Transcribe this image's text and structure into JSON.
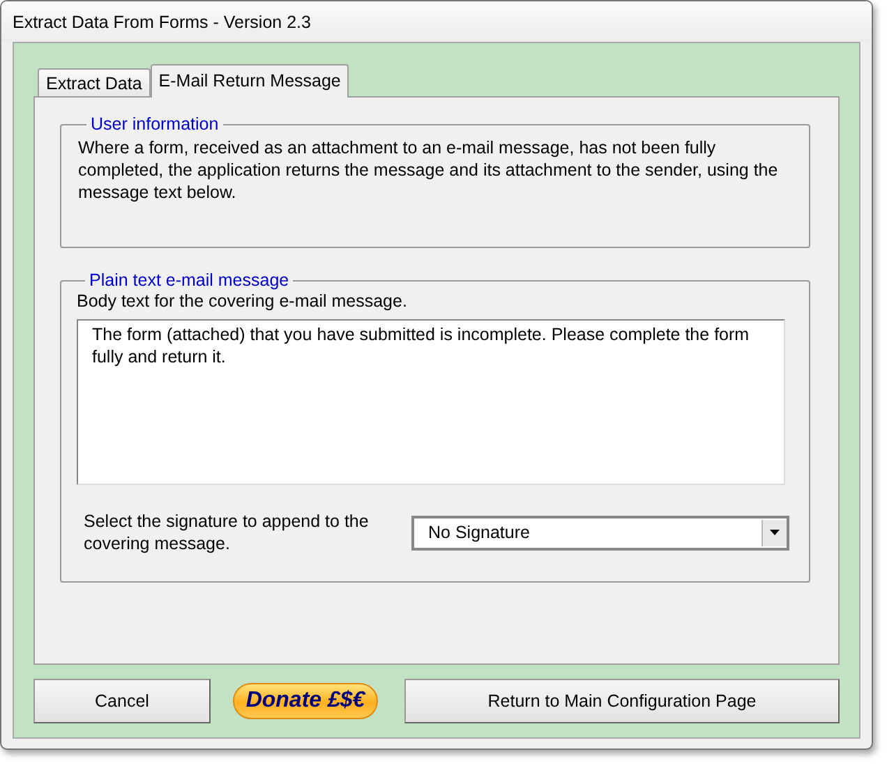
{
  "window": {
    "title": "Extract Data From Forms - Version 2.3"
  },
  "tabs": [
    {
      "label": "Extract Data",
      "selected": false
    },
    {
      "label": "E-Mail Return Message",
      "selected": true
    }
  ],
  "user_information": {
    "legend": "User information",
    "text": "Where a form, received as an attachment to an e-mail message, has not been fully completed, the application returns the message and its attachment to the sender, using the message text below."
  },
  "plain_text_message": {
    "legend": "Plain text e-mail message",
    "label": "Body text for the covering e-mail message.",
    "value": "The form (attached) that you have submitted is incomplete. Please complete the form fully and return it.",
    "signature_label": "Select the signature to append to the covering message.",
    "signature_value": "No Signature"
  },
  "buttons": {
    "cancel": "Cancel",
    "donate": "Donate £$€",
    "return": "Return to Main Configuration Page"
  }
}
